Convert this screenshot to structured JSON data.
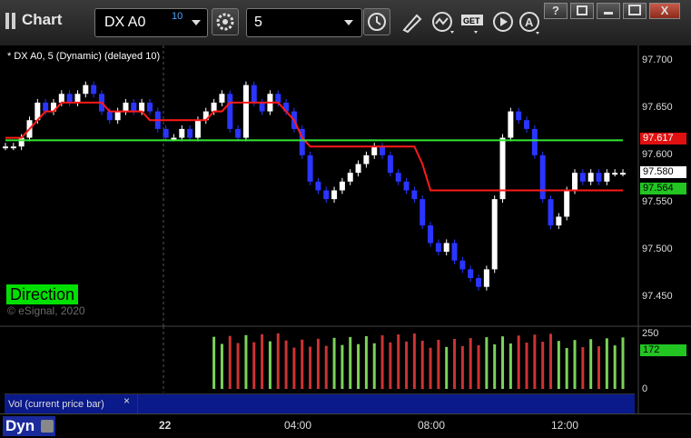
{
  "window": {
    "title": "Chart"
  },
  "toolbar": {
    "symbol": "DX A0",
    "delay_badge": "10",
    "interval": "5",
    "buttons": [
      "gear-icon",
      "clock-icon",
      "pencil-icon",
      "line-chart-icon",
      "get-icon",
      "play-icon",
      "a-icon"
    ]
  },
  "window_controls": {
    "help": "?",
    "restore": "",
    "minimize": "",
    "maximize": "",
    "close": "X"
  },
  "study_label": "* DX A0, 5 (Dynamic) (delayed 10)",
  "direction_label": "Direction",
  "copyright": "© eSignal, 2020",
  "price_axis": {
    "ticks": [
      "97.700",
      "97.650",
      "97.600",
      "97.550",
      "97.500",
      "97.450"
    ],
    "tag_red": "97.617",
    "tag_last": "97.580",
    "tag_green": "97.564"
  },
  "volume": {
    "label": "Vol (current price bar)",
    "close": "×",
    "ticks": [
      "250",
      "0"
    ],
    "tag": "172"
  },
  "time_axis": {
    "ticks": [
      "22",
      "04:00",
      "08:00",
      "12:00"
    ]
  },
  "footer": {
    "dyn": "Dyn"
  },
  "colors": {
    "up": "#ffffff",
    "down": "#2a35ff",
    "red_line": "#ff1a1a",
    "green_line": "#33e633",
    "vol_up": "#7ad35a",
    "vol_down": "#cc3333"
  },
  "chart_data": {
    "type": "candlestick",
    "price_range": [
      97.43,
      97.72
    ],
    "closes": [
      97.61,
      97.61,
      97.62,
      97.64,
      97.66,
      97.65,
      97.66,
      97.67,
      97.66,
      97.67,
      97.68,
      97.67,
      97.65,
      97.64,
      97.65,
      97.66,
      97.65,
      97.66,
      97.65,
      97.63,
      97.62,
      97.62,
      97.63,
      97.62,
      97.64,
      97.65,
      97.66,
      97.67,
      97.63,
      97.62,
      97.68,
      97.66,
      97.65,
      97.67,
      97.66,
      97.65,
      97.63,
      97.6,
      97.57,
      97.56,
      97.55,
      97.56,
      97.57,
      97.58,
      97.59,
      97.6,
      97.61,
      97.6,
      97.58,
      97.57,
      97.56,
      97.55,
      97.52,
      97.5,
      97.49,
      97.5,
      97.48,
      97.47,
      97.46,
      97.45,
      97.47,
      97.55,
      97.62,
      97.65,
      97.64,
      97.63,
      97.6,
      97.55,
      97.52,
      97.53,
      97.56,
      97.58,
      97.57,
      97.58,
      97.57,
      97.58,
      97.58,
      97.58
    ],
    "red_line": [
      97.62,
      97.62,
      97.62,
      97.63,
      97.64,
      97.65,
      97.65,
      97.66,
      97.66,
      97.66,
      97.66,
      97.66,
      97.66,
      97.65,
      97.65,
      97.65,
      97.65,
      97.65,
      97.64,
      97.64,
      97.64,
      97.64,
      97.64,
      97.64,
      97.64,
      97.64,
      97.65,
      97.65,
      97.66,
      97.66,
      97.66,
      97.66,
      97.66,
      97.66,
      97.66,
      97.65,
      97.64,
      97.62,
      97.61,
      97.61,
      97.61,
      97.61,
      97.61,
      97.61,
      97.61,
      97.61,
      97.61,
      97.61,
      97.61,
      97.61,
      97.61,
      97.61,
      97.59,
      97.56,
      97.56,
      97.56,
      97.56,
      97.56,
      97.56,
      97.56,
      97.56,
      97.56,
      97.56,
      97.56,
      97.56,
      97.56,
      97.56,
      97.56,
      97.56,
      97.56,
      97.56,
      97.56,
      97.56,
      97.56,
      97.56,
      97.56,
      97.56,
      97.56
    ],
    "green_line": [
      97.617,
      97.617,
      97.617,
      97.617,
      97.617,
      97.617,
      97.617,
      97.617,
      97.617,
      97.617,
      97.617,
      97.617,
      97.617,
      97.617,
      97.617,
      97.617,
      97.617,
      97.617,
      97.617,
      97.617,
      97.617,
      97.617,
      97.617,
      97.617,
      97.617,
      97.617,
      97.617,
      97.617,
      97.617,
      97.617,
      97.617,
      97.617,
      97.617,
      97.617,
      97.617,
      97.617,
      97.617,
      97.617,
      97.617,
      97.617,
      97.617,
      97.617,
      97.617,
      97.617,
      97.617,
      97.617,
      97.617,
      97.617,
      97.617,
      97.617,
      97.617,
      97.617,
      97.617,
      97.617,
      97.617,
      97.617,
      97.617,
      97.617,
      97.617,
      97.617,
      97.617,
      97.617,
      97.617,
      97.617,
      97.617,
      97.617,
      97.617,
      97.617,
      97.617,
      97.617,
      97.617,
      97.617,
      97.617,
      97.617,
      97.617,
      97.617,
      97.617,
      97.617
    ],
    "volume_range": [
      0,
      270
    ]
  }
}
